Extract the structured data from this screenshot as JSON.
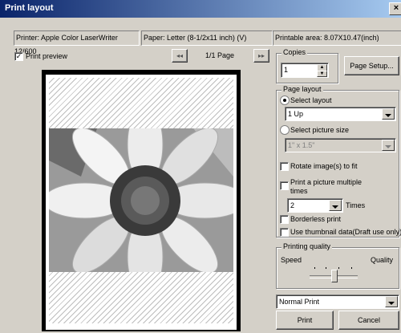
{
  "window": {
    "title": "Print layout",
    "close": "×"
  },
  "info": {
    "printer": "Printer: Apple Color LaserWriter 12/600",
    "paper": "Paper: Letter (8-1/2x11 inch) (V)",
    "area": "Printable area: 8.07X10.47(inch)"
  },
  "preview_toggle": {
    "label": "Print preview",
    "checked": true
  },
  "pager": {
    "prev": "◂◂",
    "page": "1/1 Page",
    "next": "▸▸"
  },
  "copies": {
    "legend": "Copies",
    "value": "1"
  },
  "page_setup": "Page Setup...",
  "page_layout": {
    "legend": "Page layout",
    "select_layout": "Select layout",
    "layout_value": "1 Up",
    "select_picture_size": "Select picture size",
    "picture_size_value": "1\" x 1.5\"",
    "rotate": "Rotate image(s) to fit",
    "multiple_line1": "Print a picture multiple",
    "multiple_line2": "times",
    "times_value": "2",
    "times_label": "Times",
    "borderless": "Borderless print",
    "thumbnail": "Use thumbnail data(Draft use only)"
  },
  "quality": {
    "legend": "Printing quality",
    "speed": "Speed",
    "quality": "Quality",
    "level": 0.5
  },
  "print_mode": "Normal Print",
  "buttons": {
    "print": "Print",
    "cancel": "Cancel"
  },
  "preview_image": {
    "subject": "sunflower-photo",
    "colors": {
      "petal": "#e8e8e8",
      "center": "#303030"
    }
  }
}
